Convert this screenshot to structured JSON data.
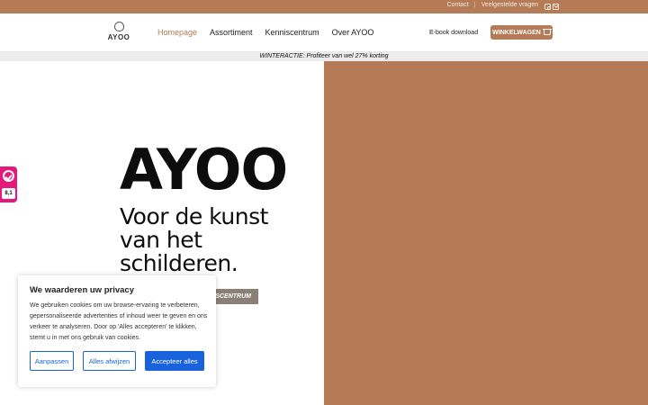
{
  "topbar": {
    "contact": "Contact",
    "faq": "Veelgestelde vragen",
    "icons": [
      "instagram-icon",
      "mail-icon"
    ]
  },
  "header": {
    "logo_text": "AYOO",
    "nav": [
      "Homepage",
      "Assortiment",
      "Kenniscentrum",
      "Over AYOO"
    ],
    "active_nav": "Homepage",
    "ebook": "E-book download",
    "cart": "WINKELWAGEN"
  },
  "promo": "WINTERACTIE: Profiteer van wel 27% korting",
  "hero": {
    "title": "AYOO",
    "subtitle": "Voor de kunst van het schilderen.",
    "button": "SCENTRUM"
  },
  "side_widget": {
    "score": "8,1"
  },
  "cookie": {
    "title": "We waarderen uw privacy",
    "text": "We gebruiken cookies om uw browse-ervaring te verbeteren, gepersonaliseerde advertenties of inhoud weer te geven en ons verkeer te analyseren. Door op 'Alles accepteren' te klikken, stemt u in met ons gebruik van cookies.",
    "customize": "Aanpassen",
    "reject": "Alles afwijzen",
    "accept": "Accepteer alles"
  },
  "colors": {
    "brand": "#b47b56",
    "accept_blue": "#1863dc",
    "widget_pink": "#e5197a"
  }
}
